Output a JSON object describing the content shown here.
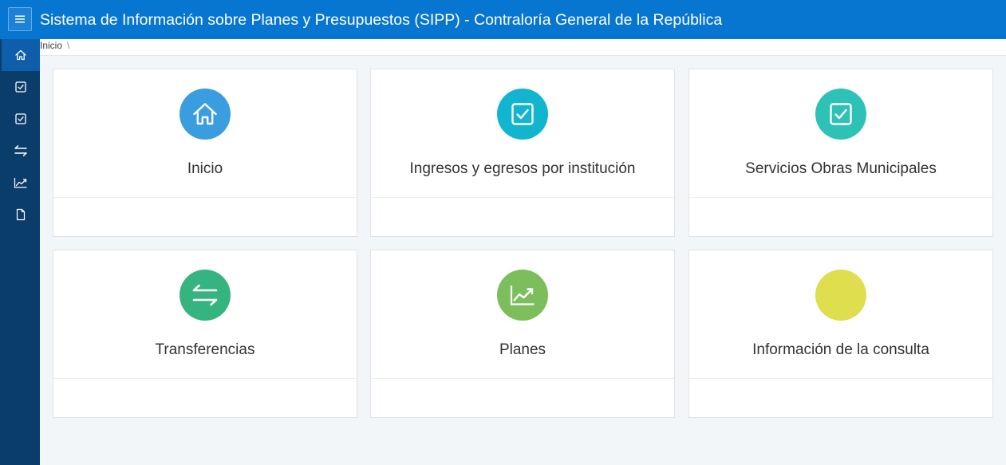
{
  "header": {
    "title": "Sistema de Información sobre Planes y Presupuestos (SIPP) - Contraloría General de la República",
    "menu_icon": "hamburger-icon",
    "color": "#0776d1"
  },
  "sidebar": {
    "color": "#0b3d6b",
    "active_color": "#0e5eab",
    "items": [
      {
        "icon": "home-icon",
        "active": true
      },
      {
        "icon": "checkbox-icon",
        "active": false
      },
      {
        "icon": "checkbox-icon",
        "active": false
      },
      {
        "icon": "transfer-arrows-icon",
        "active": false
      },
      {
        "icon": "line-chart-icon",
        "active": false
      },
      {
        "icon": "document-icon",
        "active": false
      }
    ]
  },
  "breadcrumb": {
    "items": [
      "Inicio"
    ],
    "separator": "\\"
  },
  "cards": [
    {
      "title": "Inicio",
      "icon": "home-icon",
      "color": "#3a9de0"
    },
    {
      "title": "Ingresos y egresos por institución",
      "icon": "checkbox-icon",
      "color": "#12b5d0"
    },
    {
      "title": "Servicios Obras Municipales",
      "icon": "checkbox-icon",
      "color": "#2ec2b6"
    },
    {
      "title": "Transferencias",
      "icon": "transfer-arrows-icon",
      "color": "#36b47f"
    },
    {
      "title": "Planes",
      "icon": "line-chart-icon",
      "color": "#7dbe5c"
    },
    {
      "title": "Información de la consulta",
      "icon": "",
      "color": "#dede4e"
    }
  ]
}
